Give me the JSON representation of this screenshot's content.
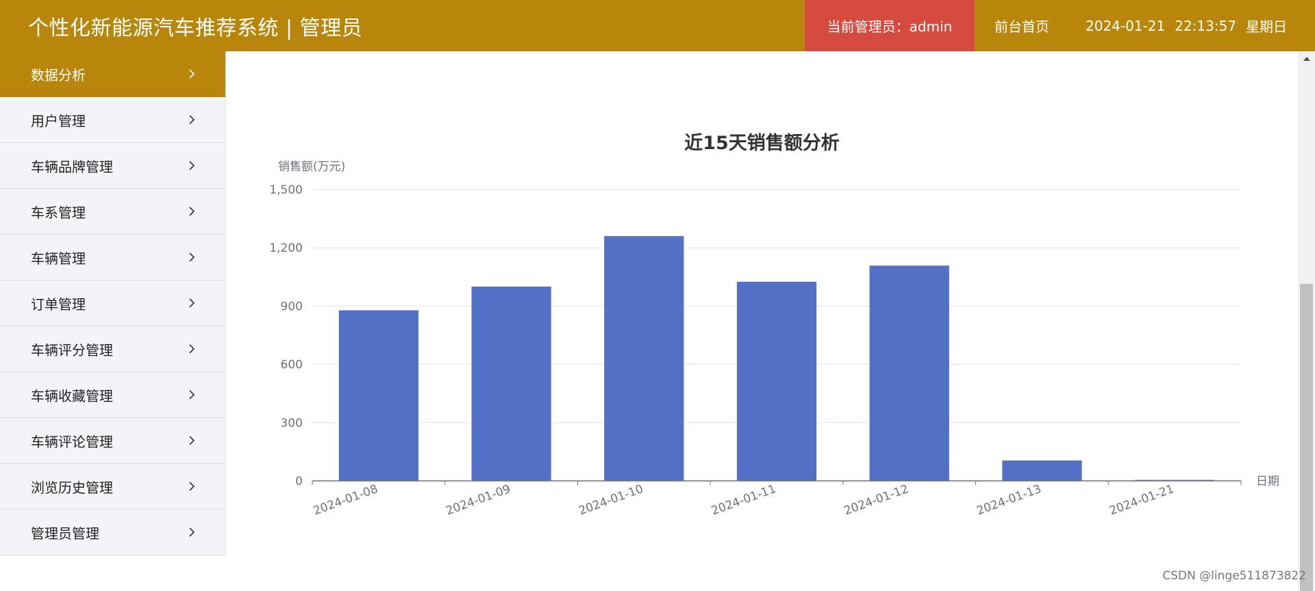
{
  "header": {
    "title": "个性化新能源汽车推荐系统 | 管理员",
    "admin_label": "当前管理员：admin",
    "home_link": "前台首页",
    "date": "2024-01-21",
    "time": "22:13:57",
    "weekday": "星期日"
  },
  "sidebar": {
    "items": [
      {
        "label": "数据分析",
        "active": true
      },
      {
        "label": "用户管理"
      },
      {
        "label": "车辆品牌管理"
      },
      {
        "label": "车系管理"
      },
      {
        "label": "车辆管理"
      },
      {
        "label": "订单管理"
      },
      {
        "label": "车辆评分管理"
      },
      {
        "label": "车辆收藏管理"
      },
      {
        "label": "车辆评论管理"
      },
      {
        "label": "浏览历史管理"
      },
      {
        "label": "管理员管理"
      }
    ]
  },
  "colors": {
    "header_bg": "#b8860b",
    "admin_bg": "#d64b3f",
    "bar": "#5470c6"
  },
  "chart_data": {
    "type": "bar",
    "title": "近15天销售额分析",
    "ylabel": "销售额(万元)",
    "xlabel": "日期",
    "categories": [
      "2024-01-08",
      "2024-01-09",
      "2024-01-10",
      "2024-01-11",
      "2024-01-12",
      "2024-01-13",
      "2024-01-21"
    ],
    "values": [
      878,
      1000,
      1260,
      1025,
      1108,
      105,
      5
    ],
    "ylim": [
      0,
      1500
    ],
    "yticks": [
      0,
      300,
      600,
      900,
      1200,
      1500
    ],
    "ytick_labels": [
      "0",
      "300",
      "600",
      "900",
      "1,200",
      "1,500"
    ],
    "grid": true
  },
  "watermark": "CSDN @linge511873822"
}
